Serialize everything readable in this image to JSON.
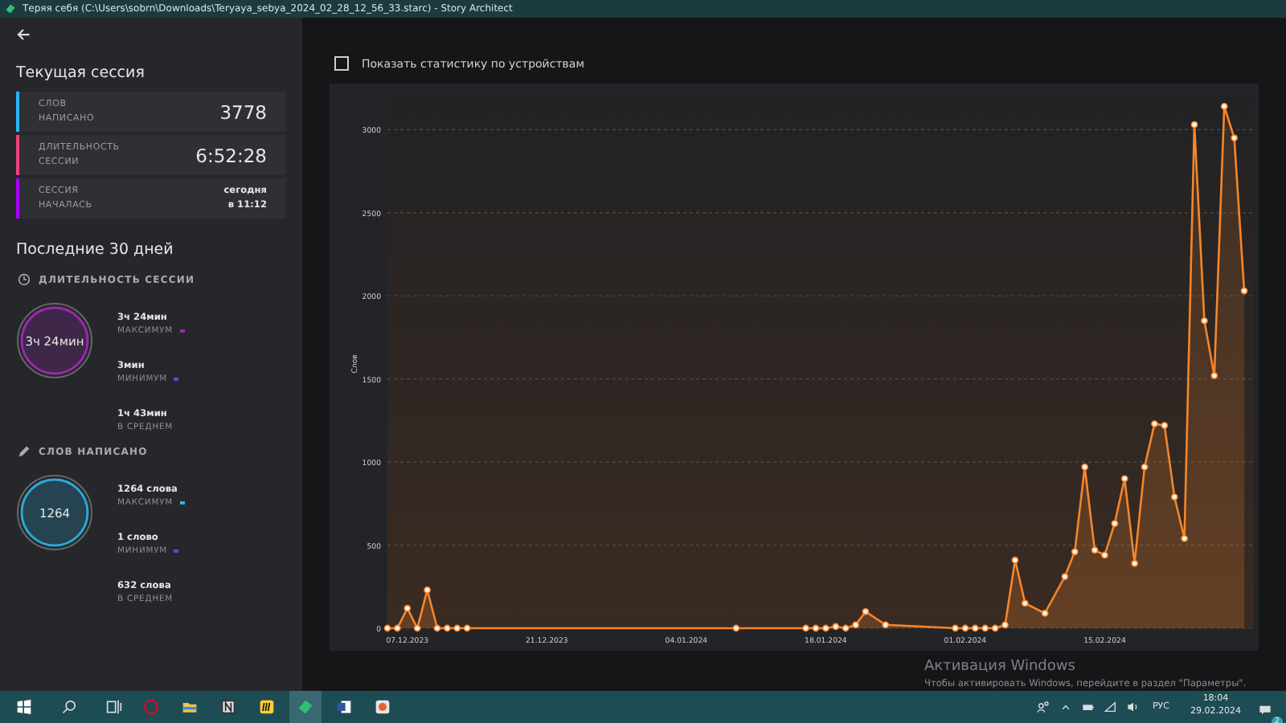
{
  "window": {
    "title": "Теряя себя (C:\\Users\\sobrn\\Downloads\\Teryaya_sebya_2024_02_28_12_56_33.starc) - Story Architect"
  },
  "sidebar": {
    "current_session": {
      "title": "Текущая сессия",
      "cards": [
        {
          "label_lines": [
            "СЛОВ",
            "НАПИСАНО"
          ],
          "value_lines": [
            "3778"
          ],
          "color": "#29b6f6",
          "kind": "big"
        },
        {
          "label_lines": [
            "ДЛИТЕЛЬНОСТЬ",
            "СЕССИИ"
          ],
          "value_lines": [
            "6:52:28"
          ],
          "color": "#ec407a",
          "kind": "big"
        },
        {
          "label_lines": [
            "СЕССИЯ",
            "НАЧАЛАСЬ"
          ],
          "value_lines": [
            "сегодня",
            "в 11:12"
          ],
          "color": "#aa00ff",
          "kind": "small"
        }
      ]
    },
    "last_30_days": {
      "title": "Последние 30 дней",
      "sections": [
        {
          "heading": "ДЛИТЕЛЬНОСТЬ СЕССИИ",
          "kind": "duration",
          "center": "3ч 24мин",
          "color": "#9c27b0",
          "stats": [
            {
              "value": "3ч 24мин",
              "label": "МАКСИМУМ",
              "color": "#9c27b0"
            },
            {
              "value": "3мин",
              "label": "МИНИМУМ",
              "color": "#5c4bd6"
            },
            {
              "value": "1ч 43мин",
              "label": "В СРЕДНЕМ"
            }
          ]
        },
        {
          "heading": "СЛОВ НАПИСАНО",
          "kind": "words",
          "center": "1264",
          "color": "#29a9d6",
          "stats": [
            {
              "value": "1264 слова",
              "label": "МАКСИМУМ",
              "color": "#29b6f6"
            },
            {
              "value": "1 слово",
              "label": "МИНИМУМ",
              "color": "#5c4bd6"
            },
            {
              "value": "632 слова",
              "label": "В СРЕДНЕМ"
            }
          ]
        }
      ]
    }
  },
  "main": {
    "device_checkbox": {
      "label": "Показать статистику по устройствам",
      "checked": false
    },
    "chart_data": {
      "type": "area",
      "ylabel": "Слов",
      "categories": [
        null,
        null,
        "07.12.2023",
        null,
        null,
        null,
        null,
        null,
        null,
        null,
        null,
        null,
        null,
        null,
        null,
        null,
        "21.12.2023",
        null,
        null,
        null,
        null,
        null,
        null,
        null,
        null,
        null,
        null,
        null,
        null,
        null,
        "04.01.2024",
        null,
        null,
        null,
        null,
        null,
        null,
        null,
        null,
        null,
        null,
        null,
        null,
        null,
        "18.01.2024",
        null,
        null,
        null,
        null,
        null,
        null,
        null,
        null,
        null,
        null,
        null,
        null,
        null,
        "01.02.2024",
        null,
        null,
        null,
        null,
        null,
        null,
        null,
        null,
        null,
        null,
        null,
        null,
        null,
        "15.02.2024",
        null,
        null,
        null,
        null,
        null,
        null,
        null,
        null,
        null,
        null,
        null,
        null,
        null,
        null
      ],
      "series": [
        {
          "color": "#f5862b",
          "values": [
            0,
            0,
            120,
            0,
            230,
            0,
            0,
            0,
            0,
            null,
            null,
            null,
            null,
            null,
            null,
            null,
            null,
            null,
            null,
            null,
            null,
            null,
            null,
            null,
            null,
            null,
            null,
            null,
            null,
            null,
            null,
            null,
            null,
            null,
            null,
            0,
            null,
            null,
            null,
            null,
            null,
            null,
            0,
            0,
            0,
            10,
            0,
            20,
            100,
            null,
            20,
            null,
            null,
            null,
            null,
            null,
            null,
            0,
            0,
            0,
            0,
            0,
            20,
            410,
            150,
            null,
            90,
            null,
            310,
            460,
            970,
            470,
            440,
            630,
            900,
            390,
            970,
            1230,
            1220,
            790,
            540,
            3030,
            1850,
            1520,
            3140,
            2950,
            2030
          ]
        }
      ],
      "ylim": [
        0,
        3200
      ],
      "grid": true,
      "yticks": [
        0,
        500,
        1000,
        1500,
        2000,
        2500,
        3000
      ]
    }
  },
  "activation_notice": {
    "title": "Активация Windows",
    "text": "Чтобы активировать Windows, перейдите в раздел \"Параметры\"."
  },
  "taskbar": {
    "apps": [
      {
        "kind": "opera",
        "selected": false
      },
      {
        "kind": "folder",
        "selected": false
      },
      {
        "kind": "notion",
        "selected": false
      },
      {
        "kind": "miro",
        "selected": false
      },
      {
        "kind": "story",
        "selected": true
      },
      {
        "kind": "word",
        "selected": false
      },
      {
        "kind": "paint",
        "selected": false
      }
    ],
    "language": "РУС",
    "time": "18:04",
    "date": "29.02.2024",
    "notifications": "2"
  }
}
